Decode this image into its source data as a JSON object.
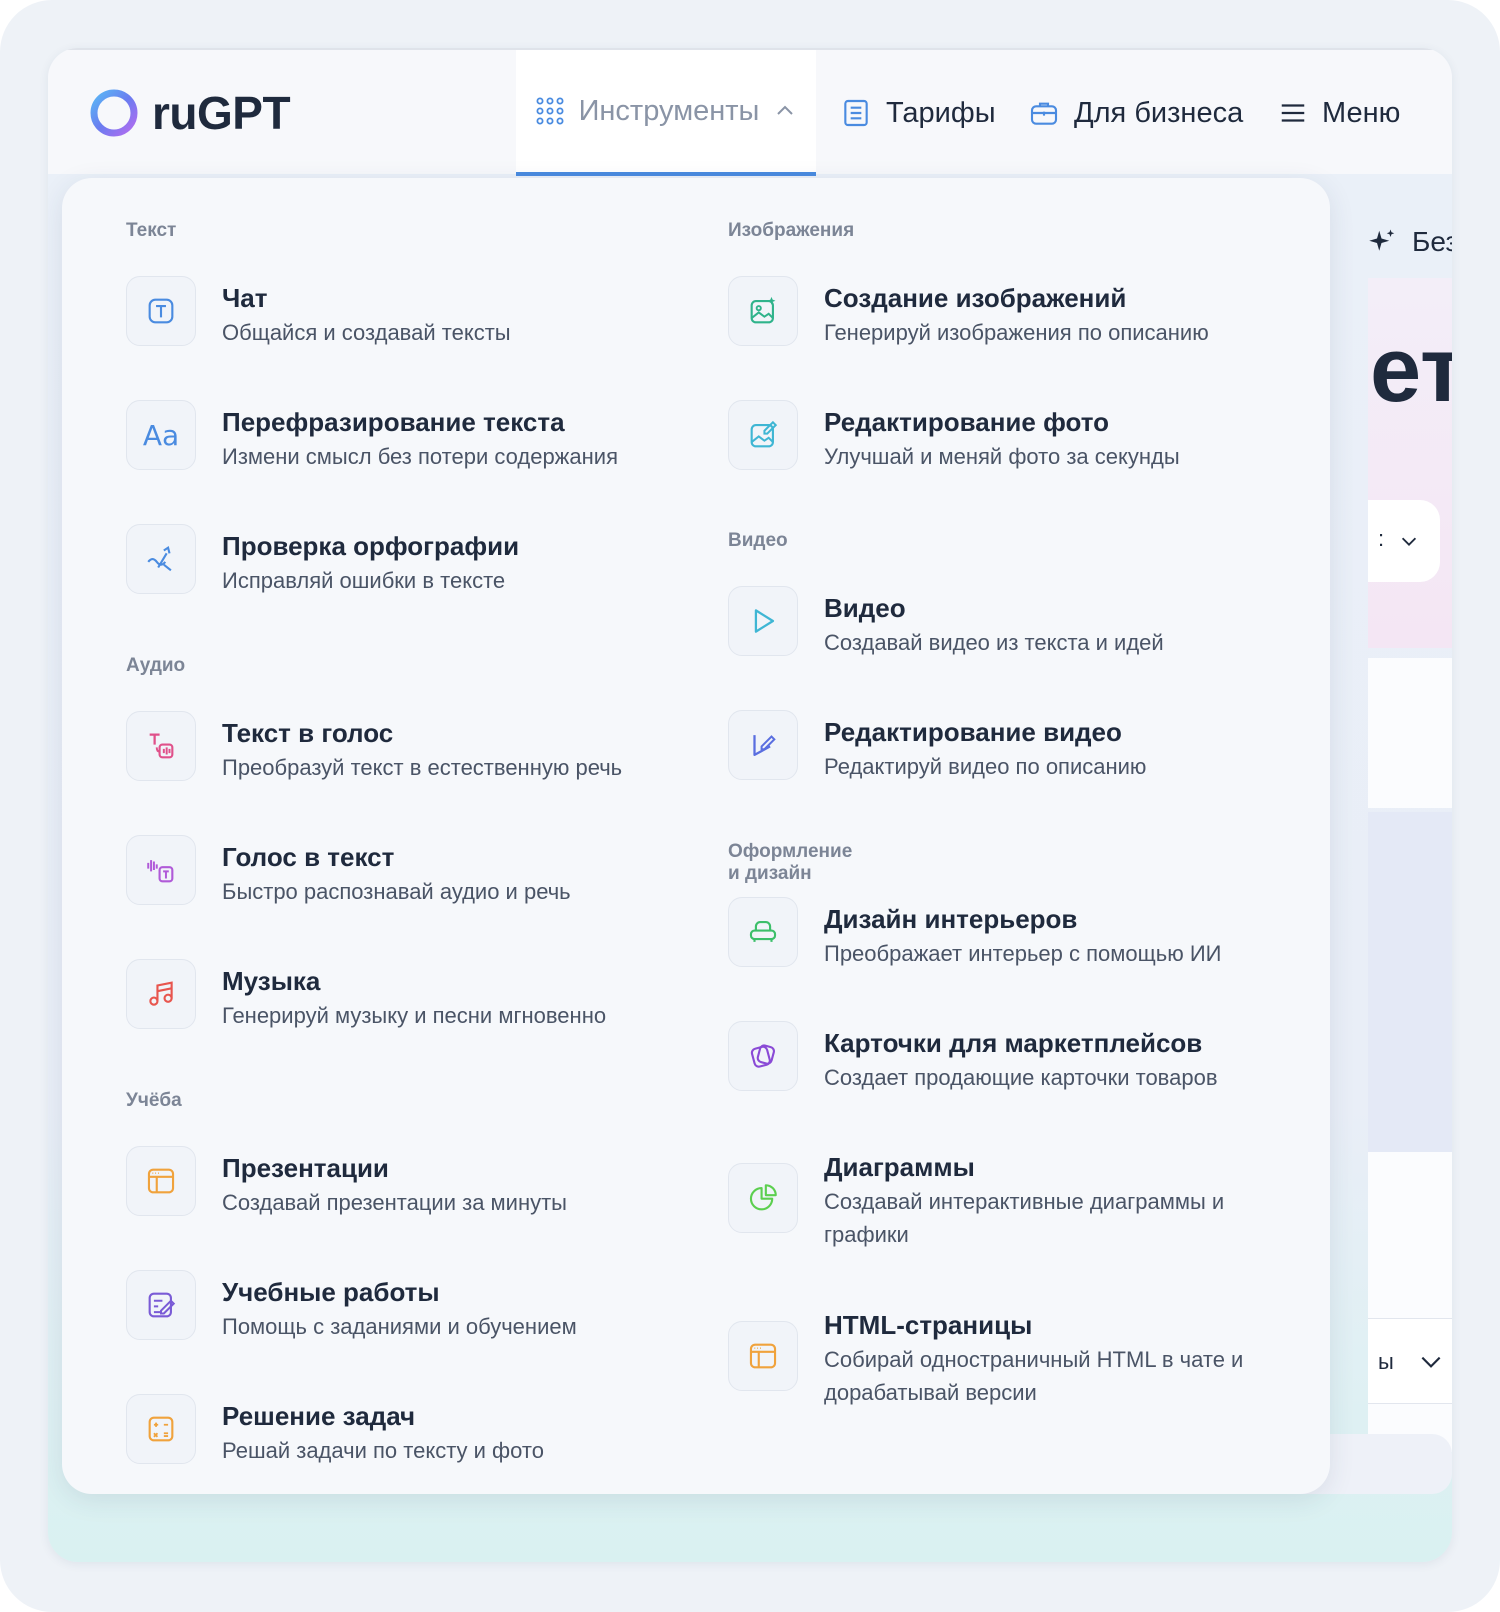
{
  "app": {
    "logo_text": "ruGPT"
  },
  "nav": {
    "tools": "Инструменты",
    "tariffs": "Тарифы",
    "business": "Для бизнеса",
    "menu": "Меню"
  },
  "background": {
    "badge_partial": "Без",
    "heading_partial": "ет",
    "select_partial": ":",
    "dropdown_partial": "ы"
  },
  "sections": {
    "text": {
      "title": "Текст",
      "items": [
        {
          "title": "Чат",
          "desc": "Общайся и создавай тексты",
          "icon": "text-t-icon"
        },
        {
          "title": "Перефразирование текста",
          "desc": "Измени смысл без потери содержания",
          "icon": "aa-icon"
        },
        {
          "title": "Проверка орфографии",
          "desc": "Исправляй ошибки в тексте",
          "icon": "spellcheck-icon"
        }
      ]
    },
    "audio": {
      "title": "Аудио",
      "items": [
        {
          "title": "Текст в голос",
          "desc": "Преобразуй текст в естественную речь",
          "icon": "text-to-speech-icon"
        },
        {
          "title": "Голос в текст",
          "desc": "Быстро распознавай аудио и речь",
          "icon": "speech-to-text-icon"
        },
        {
          "title": "Музыка",
          "desc": "Генерируй музыку и песни мгновенно",
          "icon": "music-note-icon"
        }
      ]
    },
    "study": {
      "title": "Учёба",
      "items": [
        {
          "title": "Презентации",
          "desc": "Создавай презентации за минуты",
          "icon": "presentation-icon"
        },
        {
          "title": "Учебные работы",
          "desc": "Помощь с заданиями и обучением",
          "icon": "edit-document-icon"
        },
        {
          "title": "Решение задач",
          "desc": "Решай задачи по тексту и фото",
          "icon": "calculator-icon"
        }
      ]
    },
    "images": {
      "title": "Изображения",
      "items": [
        {
          "title": "Создание изображений",
          "desc": "Генерируй изображения по описанию",
          "icon": "image-sparkle-icon"
        },
        {
          "title": "Редактирование фото",
          "desc": "Улучшай и меняй фото за секунды",
          "icon": "image-edit-icon"
        }
      ]
    },
    "video": {
      "title": "Видео",
      "items": [
        {
          "title": "Видео",
          "desc": "Создавай видео из текста и идей",
          "icon": "play-icon"
        },
        {
          "title": "Редактирование видео",
          "desc": "Редактируй видео по описанию",
          "icon": "video-edit-icon"
        }
      ]
    },
    "design": {
      "title": "Оформление и дизайн",
      "items": [
        {
          "title": "Дизайн интерьеров",
          "desc": "Преображает интерьер с помощью ИИ",
          "icon": "armchair-icon"
        },
        {
          "title": "Карточки для маркетплейсов",
          "desc": "Создает продающие карточки товаров",
          "icon": "cards-icon"
        },
        {
          "title": "Диаграммы",
          "desc": "Создавай интерактивные диаграммы и графики",
          "icon": "pie-chart-icon"
        },
        {
          "title": "HTML-страницы",
          "desc": "Собирай одностраничный HTML в чате и дорабатывай версии",
          "icon": "html-page-icon"
        }
      ]
    }
  },
  "colors": {
    "accent": "#4a8be0",
    "text_dark": "#1f2a3d",
    "text_muted": "#7c8596"
  }
}
